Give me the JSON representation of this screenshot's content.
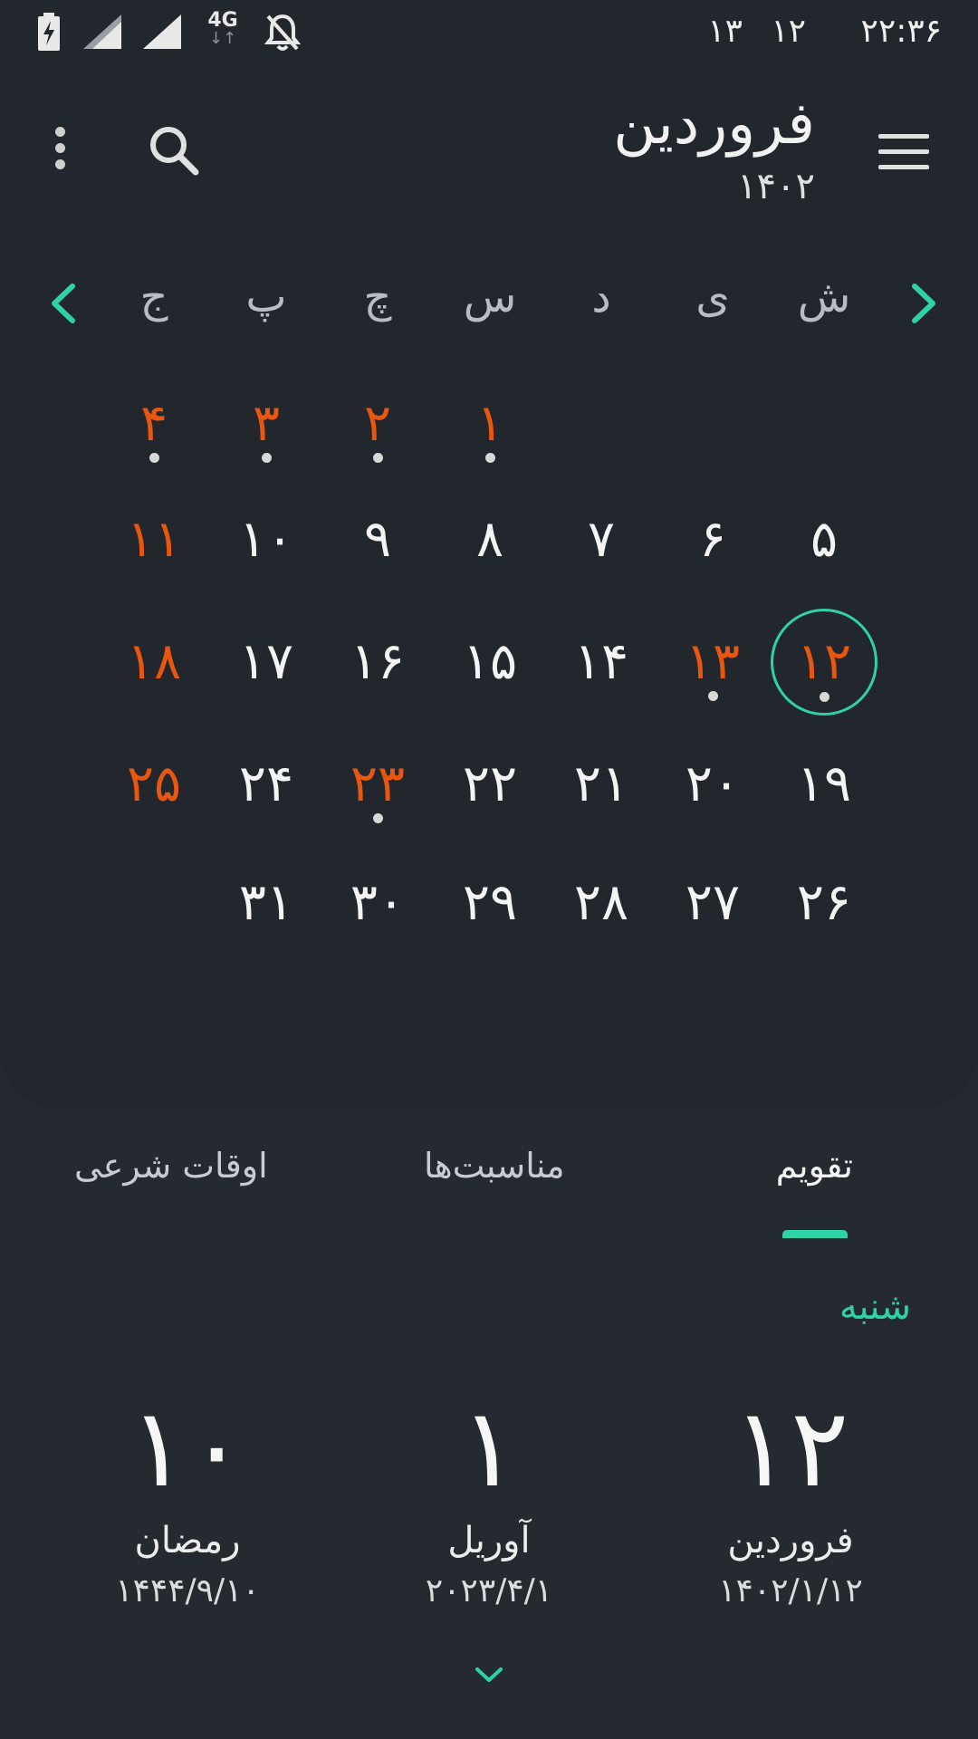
{
  "status_bar": {
    "time": "۲۲:۳۶",
    "date_a": "۱۲",
    "date_b": "۱۳",
    "network_label": "4G",
    "icons": [
      "battery-charging-icon",
      "signal-icon",
      "signal-icon",
      "4g-data-icon",
      "notifications-off-icon"
    ]
  },
  "header": {
    "month": "فروردین",
    "year": "۱۴۰۲",
    "menu_icon": "hamburger-menu-icon",
    "search_icon": "search-icon",
    "more_icon": "more-vertical-icon"
  },
  "weekdays": [
    "ش",
    "ی",
    "د",
    "س",
    "چ",
    "پ",
    "ج"
  ],
  "calendar_rows": [
    [
      {
        "d": "",
        "h": false,
        "dot": false
      },
      {
        "d": "",
        "h": false,
        "dot": false
      },
      {
        "d": "",
        "h": false,
        "dot": false
      },
      {
        "d": "۱",
        "h": true,
        "dot": true
      },
      {
        "d": "۲",
        "h": true,
        "dot": true
      },
      {
        "d": "۳",
        "h": true,
        "dot": true
      },
      {
        "d": "۴",
        "h": true,
        "dot": true
      }
    ],
    [
      {
        "d": "۵",
        "h": false,
        "dot": false
      },
      {
        "d": "۶",
        "h": false,
        "dot": false
      },
      {
        "d": "۷",
        "h": false,
        "dot": false
      },
      {
        "d": "۸",
        "h": false,
        "dot": false
      },
      {
        "d": "۹",
        "h": false,
        "dot": false
      },
      {
        "d": "۱۰",
        "h": false,
        "dot": false
      },
      {
        "d": "۱۱",
        "h": true,
        "dot": false
      }
    ],
    [
      {
        "d": "۱۲",
        "h": true,
        "dot": true,
        "today": true
      },
      {
        "d": "۱۳",
        "h": true,
        "dot": true
      },
      {
        "d": "۱۴",
        "h": false,
        "dot": false
      },
      {
        "d": "۱۵",
        "h": false,
        "dot": false
      },
      {
        "d": "۱۶",
        "h": false,
        "dot": false
      },
      {
        "d": "۱۷",
        "h": false,
        "dot": false
      },
      {
        "d": "۱۸",
        "h": true,
        "dot": false
      }
    ],
    [
      {
        "d": "۱۹",
        "h": false,
        "dot": false
      },
      {
        "d": "۲۰",
        "h": false,
        "dot": false
      },
      {
        "d": "۲۱",
        "h": false,
        "dot": false
      },
      {
        "d": "۲۲",
        "h": false,
        "dot": false
      },
      {
        "d": "۲۳",
        "h": true,
        "dot": true
      },
      {
        "d": "۲۴",
        "h": false,
        "dot": false
      },
      {
        "d": "۲۵",
        "h": true,
        "dot": false
      }
    ],
    [
      {
        "d": "۲۶",
        "h": false,
        "dot": false
      },
      {
        "d": "۲۷",
        "h": false,
        "dot": false
      },
      {
        "d": "۲۸",
        "h": false,
        "dot": false
      },
      {
        "d": "۲۹",
        "h": false,
        "dot": false
      },
      {
        "d": "۳۰",
        "h": false,
        "dot": false
      },
      {
        "d": "۳۱",
        "h": false,
        "dot": false
      },
      {
        "d": "",
        "h": false,
        "dot": false
      }
    ]
  ],
  "tabs": [
    "تقویم",
    "مناسبت‌ها",
    "اوقات شرعی"
  ],
  "detail": {
    "weekday": "شنبه",
    "columns": [
      {
        "day": "۱۲",
        "month": "فروردین",
        "full": "۱۴۰۲/۱/۱۲"
      },
      {
        "day": "۱",
        "month": "آوریل",
        "full": "۲۰۲۳/۴/۱"
      },
      {
        "day": "۱۰",
        "month": "رمضان",
        "full": "۱۴۴۴/۹/۱۰"
      }
    ]
  },
  "colors": {
    "accent": "#2fd2a7",
    "holiday": "#e8560f",
    "background": "#252a31",
    "panel": "#22272d"
  }
}
